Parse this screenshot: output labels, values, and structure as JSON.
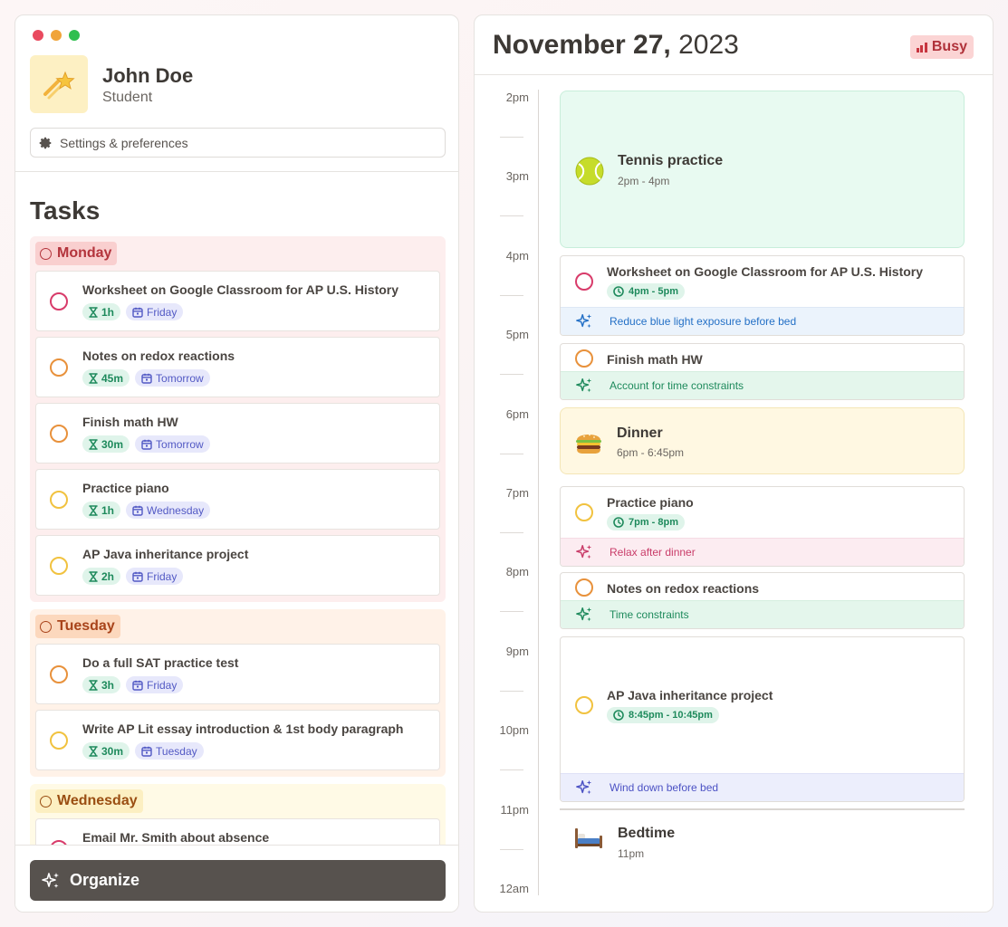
{
  "window": {
    "controls": [
      "close",
      "minimize",
      "zoom"
    ],
    "control_colors": [
      "#e94a5f",
      "#f0a43a",
      "#2fbf4f"
    ]
  },
  "user": {
    "name": "John Doe",
    "role": "Student",
    "avatar_icon": "shooting-star-icon"
  },
  "settings_label": "Settings & preferences",
  "tasks_title": "Tasks",
  "groups": [
    {
      "label": "Monday",
      "bg": "#fdeeee",
      "tag_bg": "#f9cfcf",
      "tag_color": "#b3343c",
      "tasks": [
        {
          "title": "Worksheet on Google Classroom for AP U.S. History",
          "duration": "1h",
          "day": "Friday",
          "check_color": "#d83b6a"
        },
        {
          "title": "Notes on redox reactions",
          "duration": "45m",
          "day": "Tomorrow",
          "check_color": "#e8913b"
        },
        {
          "title": "Finish math HW",
          "duration": "30m",
          "day": "Tomorrow",
          "check_color": "#e8913b"
        },
        {
          "title": "Practice piano",
          "duration": "1h",
          "day": "Wednesday",
          "check_color": "#f1c23f"
        },
        {
          "title": "AP Java inheritance project",
          "duration": "2h",
          "day": "Friday",
          "check_color": "#f1c23f"
        }
      ]
    },
    {
      "label": "Tuesday",
      "bg": "#fff2e8",
      "tag_bg": "#fcd8bd",
      "tag_color": "#a8431a",
      "tasks": [
        {
          "title": "Do a full SAT practice test",
          "duration": "3h",
          "day": "Friday",
          "check_color": "#e8913b"
        },
        {
          "title": "Write AP Lit essay introduction & 1st body paragraph",
          "duration": "30m",
          "day": "Tuesday",
          "check_color": "#f1c23f"
        }
      ]
    },
    {
      "label": "Wednesday",
      "bg": "#fffae6",
      "tag_bg": "#fcefc2",
      "tag_color": "#9a4e12",
      "tasks": [
        {
          "title": "Email Mr. Smith about absence",
          "duration": "",
          "day": "",
          "check_color": "#d83b6a"
        }
      ]
    }
  ],
  "organize_label": "Organize",
  "date": {
    "month_day": "November 27,",
    "year": "2023"
  },
  "status": {
    "label": "Busy",
    "color": "#c7353f"
  },
  "timeline": {
    "hours": [
      "2pm",
      "3pm",
      "4pm",
      "5pm",
      "6pm",
      "7pm",
      "8pm",
      "9pm",
      "10pm",
      "11pm",
      "12am"
    ]
  },
  "events": {
    "tennis": {
      "title": "Tennis practice",
      "time": "2pm - 4pm",
      "icon": "tennis-ball-icon"
    },
    "dinner": {
      "title": "Dinner",
      "time": "6pm - 6:45pm",
      "icon": "burger-icon"
    },
    "bedtime": {
      "title": "Bedtime",
      "time": "11pm",
      "icon": "bed-icon"
    }
  },
  "scheduled": [
    {
      "title": "Worksheet on Google Classroom for AP U.S. History",
      "time": "4pm - 5pm",
      "tip": "Reduce blue light exposure before bed",
      "check_color": "#d83b6a"
    },
    {
      "title": "Finish math HW",
      "time": "",
      "tip": "Account for time constraints",
      "check_color": "#e8913b"
    },
    {
      "title": "Practice piano",
      "time": "7pm - 8pm",
      "tip": "Relax after dinner",
      "check_color": "#f1c23f"
    },
    {
      "title": "Notes on redox reactions",
      "time": "",
      "tip": "Time constraints",
      "check_color": "#e8913b"
    },
    {
      "title": "AP Java inheritance project",
      "time": "8:45pm - 10:45pm",
      "tip": "Wind down before bed",
      "check_color": "#f1c23f"
    }
  ]
}
